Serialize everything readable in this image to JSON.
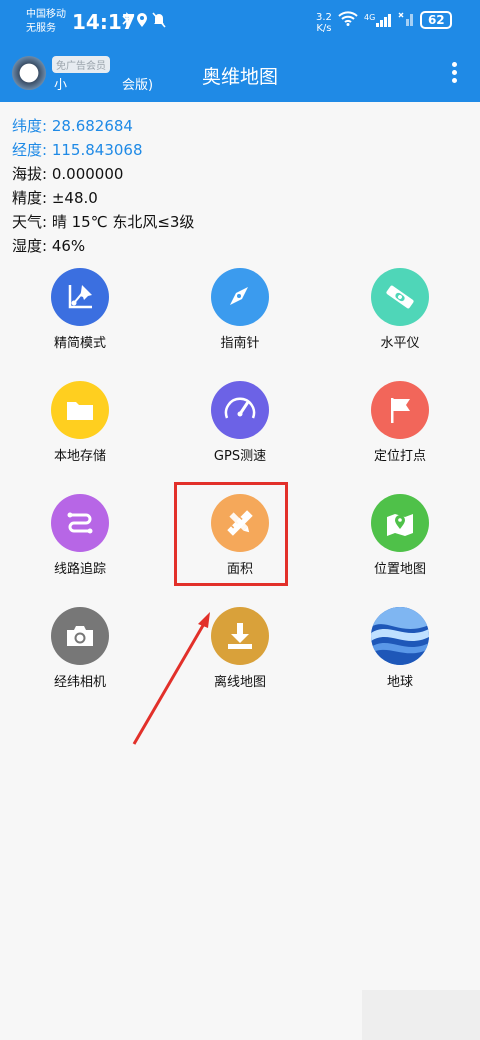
{
  "status_bar": {
    "carrier_line1": "中国移动",
    "carrier_line2": "无服务",
    "time": "14:17",
    "net_speed_value": "3.2",
    "net_speed_unit": "K/s",
    "network_type": "4G",
    "battery": "62"
  },
  "app_bar": {
    "vip_badge": "免广告会员",
    "user_name": "小",
    "user_name_suffix": "会版)",
    "title": "奥维地图"
  },
  "info": {
    "latitude_label": "纬度:",
    "latitude_value": "28.682684",
    "longitude_label": "经度:",
    "longitude_value": "115.843068",
    "altitude_label": "海拔:",
    "altitude_value": "0.000000",
    "accuracy_label": "精度:",
    "accuracy_value": "±48.0",
    "weather_label": "天气:",
    "weather_value": "晴  15℃  东北风≤3级",
    "humidity_label": "湿度:",
    "humidity_value": "46%"
  },
  "grid": [
    {
      "label": "精简模式",
      "icon": "pin-graph-icon",
      "color": "#3b6fe0"
    },
    {
      "label": "指南针",
      "icon": "compass-icon",
      "color": "#3b9bee"
    },
    {
      "label": "水平仪",
      "icon": "level-icon",
      "color": "#4fd6b8"
    },
    {
      "label": "本地存储",
      "icon": "folder-icon",
      "color": "#ffcf1f"
    },
    {
      "label": "GPS测速",
      "icon": "speedometer-icon",
      "color": "#6c62e6"
    },
    {
      "label": "定位打点",
      "icon": "flag-icon",
      "color": "#f2665a"
    },
    {
      "label": "线路追踪",
      "icon": "route-icon",
      "color": "#b766e6"
    },
    {
      "label": "面积",
      "icon": "ruler-pencil-icon",
      "color": "#f5a85a"
    },
    {
      "label": "位置地图",
      "icon": "map-location-icon",
      "color": "#4fc149"
    },
    {
      "label": "经纬相机",
      "icon": "camera-icon",
      "color": "#777777"
    },
    {
      "label": "离线地图",
      "icon": "download-icon",
      "color": "#d9a13a"
    },
    {
      "label": "地球",
      "icon": "earth-wave-icon",
      "color": "#2c6fd4"
    }
  ],
  "colors": {
    "primary": "#1f8ae6",
    "highlight": "#e2302a"
  }
}
